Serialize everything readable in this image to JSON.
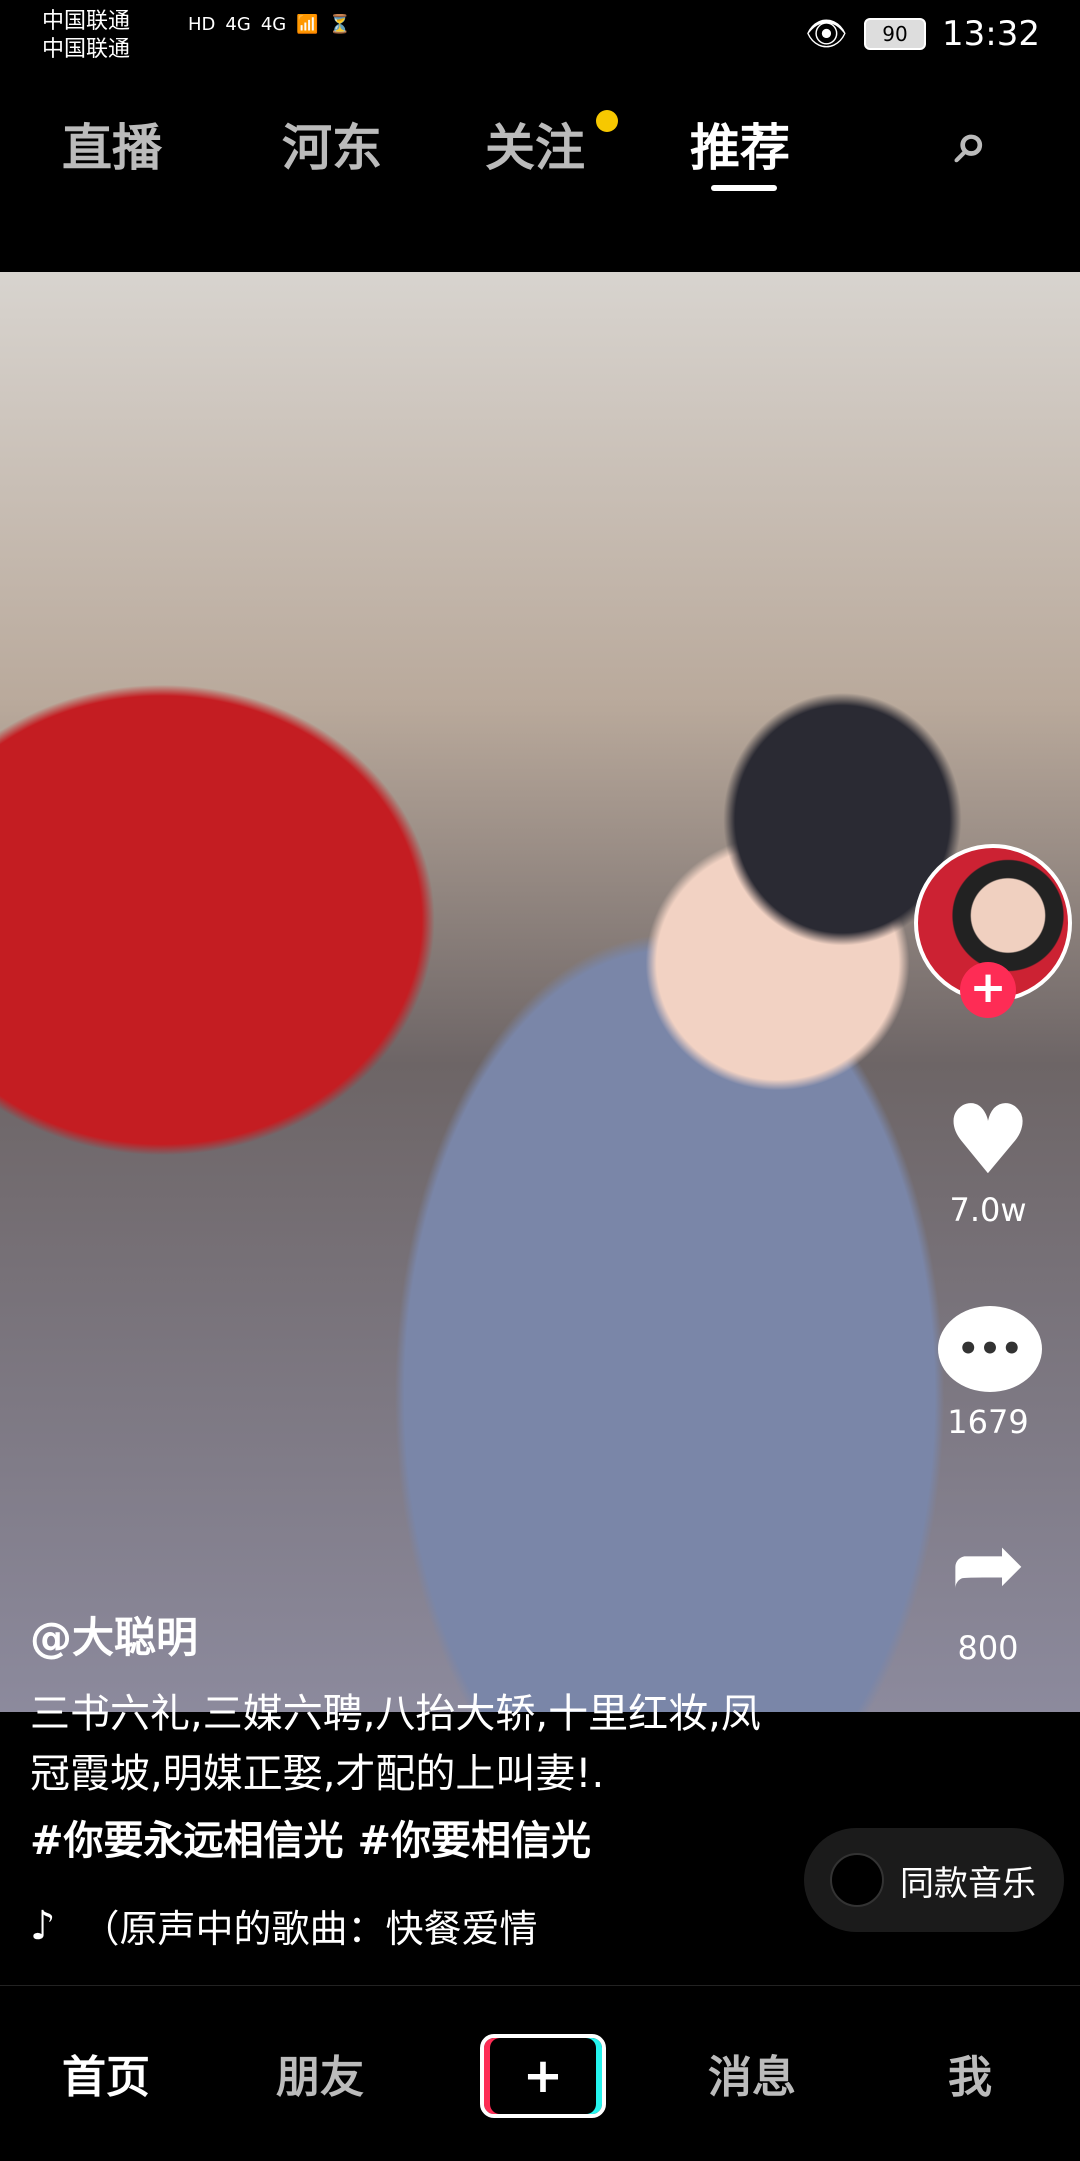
{
  "status_bar": {
    "carrier_1": "中国联通",
    "carrier_2": "中国联通",
    "signal_labels": [
      "HD",
      "4G",
      "4G"
    ],
    "battery": "90",
    "time": "13:32"
  },
  "top_nav": {
    "live_label": "直播",
    "items": [
      "河东",
      "关注",
      "推荐"
    ],
    "active_index": 2
  },
  "video": {
    "author": "@大聪明",
    "caption": "三书六礼,三媒六聘,八抬大轿,十里红妆,凤冠霞坡,明媒正娶,才配的上叫妻!.",
    "hashtags": "#你要永远相信光 #你要相信光",
    "music_title": "（原声中的歌曲：快餐爱情",
    "same_music_label": "同款音乐"
  },
  "side_actions": {
    "likes": "7.0w",
    "comments": "1679",
    "shares": "800"
  },
  "bottom_tabs": {
    "home": "首页",
    "friends": "朋友",
    "add": "+",
    "messages": "消息",
    "me": "我"
  },
  "colors": {
    "accent_red": "#fe2c55",
    "accent_cyan": "#25f4ee",
    "notify_dot": "#f7c800"
  },
  "icons": [
    "eye-icon",
    "search-icon",
    "heart-icon",
    "comment-icon",
    "share-icon",
    "tiktok-note-icon",
    "music-disc-icon"
  ]
}
